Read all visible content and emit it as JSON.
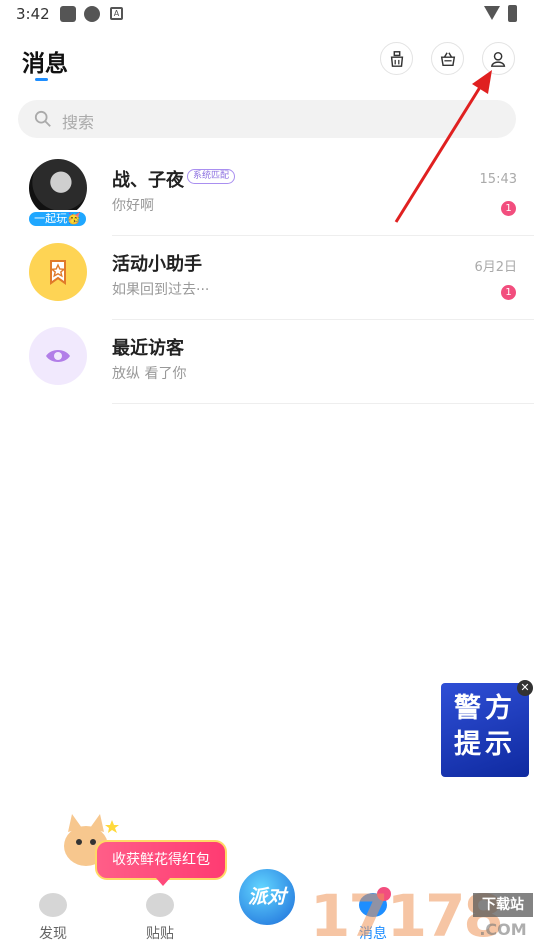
{
  "status_bar": {
    "time": "3:42"
  },
  "header": {
    "title": "消息"
  },
  "search": {
    "placeholder": "搜索"
  },
  "conversations": [
    {
      "name": "战、子夜",
      "tag": "系统匹配",
      "badge": "一起玩🥳",
      "preview": "你好啊",
      "time": "15:43",
      "unread": "1"
    },
    {
      "name": "活动小助手",
      "preview": "如果回到过去···",
      "time": "6月2日",
      "unread": "1"
    },
    {
      "name": "最近访客",
      "preview": "放纵 看了你"
    }
  ],
  "float_card": {
    "text": "警方提示"
  },
  "reward": {
    "text": "收获鲜花得红包"
  },
  "tabbar": {
    "items": [
      {
        "label": "发现"
      },
      {
        "label": "贴贴"
      },
      {
        "label": "派对"
      },
      {
        "label": "消息"
      }
    ]
  },
  "watermark": {
    "number": "17178",
    "label": "下载站",
    "domain": ".COM"
  },
  "colors": {
    "accent": "#1e8eff",
    "unread": "#f24e7e",
    "annotation_arrow": "#e02020"
  }
}
